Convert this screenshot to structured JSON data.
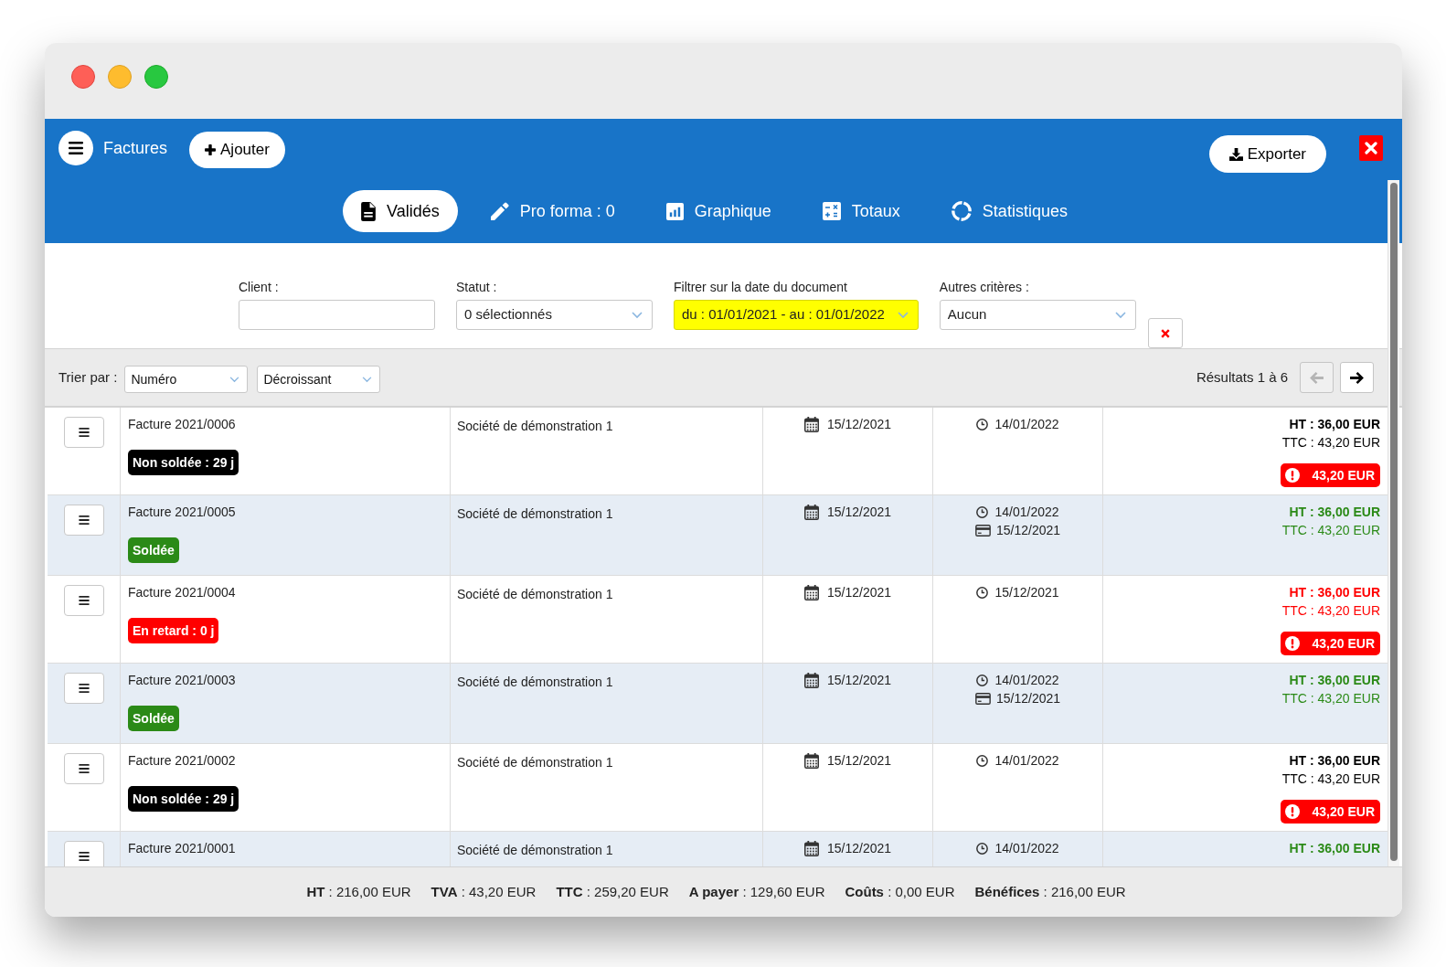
{
  "header": {
    "title": "Factures",
    "add_button": "Ajouter",
    "export_button": "Exporter"
  },
  "tabs": [
    {
      "label": "Validés",
      "selected": true
    },
    {
      "label": "Pro forma : 0",
      "selected": false
    },
    {
      "label": "Graphique",
      "selected": false
    },
    {
      "label": "Totaux",
      "selected": false
    },
    {
      "label": "Statistiques",
      "selected": false
    }
  ],
  "filters": [
    {
      "kind": "text",
      "label": "Client :",
      "highlighted": false
    },
    {
      "kind": "select",
      "label": "Statut :",
      "value": "0 sélectionnés",
      "highlighted": false
    },
    {
      "kind": "select",
      "label": "Filtrer sur la date du document",
      "value": "du : 01/01/2021 - au : 01/01/2022",
      "highlighted": true
    },
    {
      "kind": "select",
      "label": "Autres critères :",
      "value": "Aucun",
      "highlighted": false
    }
  ],
  "sort": {
    "label": "Trier par :",
    "by": "Numéro",
    "order": "Décroissant"
  },
  "pagination": {
    "results": "Résultats 1 à 6",
    "previous": {
      "disabled": true
    },
    "next": {
      "disabled": false
    }
  },
  "table": {
    "rows": [
      {
        "number": "Facture 2021/0006",
        "status": {
          "label": "Non soldée : 29 j",
          "color": "#000000"
        },
        "client": "Société de démonstration 1",
        "date": "15/12/2021",
        "due_date": "14/01/2022",
        "totals": {
          "ht": "HT : 36,00 EUR",
          "ttc": "TTC : 43,20 EUR",
          "color": "#000000"
        },
        "amount_due": "43,20 EUR"
      },
      {
        "number": "Facture 2021/0005",
        "status": {
          "label": "Soldée",
          "color": "#2b8a17"
        },
        "client": "Société de démonstration 1",
        "date": "15/12/2021",
        "due_date": "14/01/2022",
        "payment_date": "15/12/2021",
        "totals": {
          "ht": "HT : 36,00 EUR",
          "ttc": "TTC : 43,20 EUR",
          "color": "#2b8a17"
        }
      },
      {
        "number": "Facture 2021/0004",
        "status": {
          "label": "En retard : 0 j",
          "color": "#ff0000"
        },
        "client": "Société de démonstration 1",
        "date": "15/12/2021",
        "due_date": "15/12/2021",
        "totals": {
          "ht": "HT : 36,00 EUR",
          "ttc": "TTC : 43,20 EUR",
          "color": "#ff0000"
        },
        "amount_due": "43,20 EUR"
      },
      {
        "number": "Facture 2021/0003",
        "status": {
          "label": "Soldée",
          "color": "#2b8a17"
        },
        "client": "Société de démonstration 1",
        "date": "15/12/2021",
        "due_date": "14/01/2022",
        "payment_date": "15/12/2021",
        "totals": {
          "ht": "HT : 36,00 EUR",
          "ttc": "TTC : 43,20 EUR",
          "color": "#2b8a17"
        }
      },
      {
        "number": "Facture 2021/0002",
        "status": {
          "label": "Non soldée : 29 j",
          "color": "#000000"
        },
        "client": "Société de démonstration 1",
        "date": "15/12/2021",
        "due_date": "14/01/2022",
        "totals": {
          "ht": "HT : 36,00 EUR",
          "ttc": "TTC : 43,20 EUR",
          "color": "#000000"
        },
        "amount_due": "43,20 EUR"
      },
      {
        "number": "Facture 2021/0001",
        "client": "Société de démonstration 1",
        "date": "15/12/2021",
        "due_date": "14/01/2022",
        "totals": {
          "ht": "HT : 36,00 EUR",
          "color": "#2b8a17"
        }
      }
    ]
  },
  "footer": {
    "totals": [
      "**HT** : 216,00 EUR",
      "**TVA** : 43,20 EUR",
      "**TTC** : 259,20 EUR",
      "**A payer** : 129,60 EUR",
      "**Coûts** : 0,00 EUR",
      "**Bénéfices** : 216,00 EUR"
    ]
  }
}
